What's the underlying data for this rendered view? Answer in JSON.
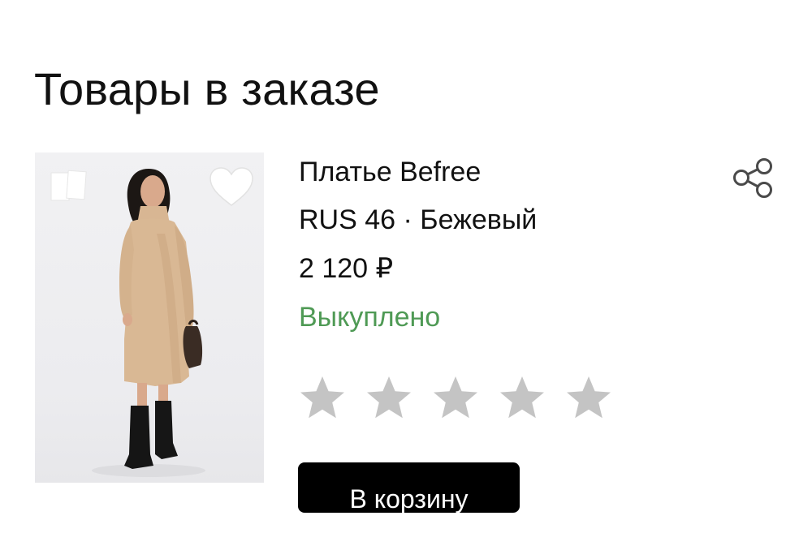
{
  "section": {
    "title": "Товары в заказе"
  },
  "product": {
    "name": "Платье Befree",
    "variant": "RUS 46 · Бежевый",
    "price": "2 120 ₽",
    "status": "Выкуплено",
    "image_description": "product-photo",
    "rating": {
      "max_stars": 5,
      "value": 0
    },
    "cart_button_label": "В корзину"
  },
  "icons": {
    "compare": "compare-icon",
    "favorite": "heart-icon",
    "share": "share-icon",
    "star": "star-icon"
  },
  "colors": {
    "status_green": "#4f9a55",
    "star_gray": "#c4c4c4",
    "button_bg": "#000000",
    "button_text": "#ffffff"
  }
}
